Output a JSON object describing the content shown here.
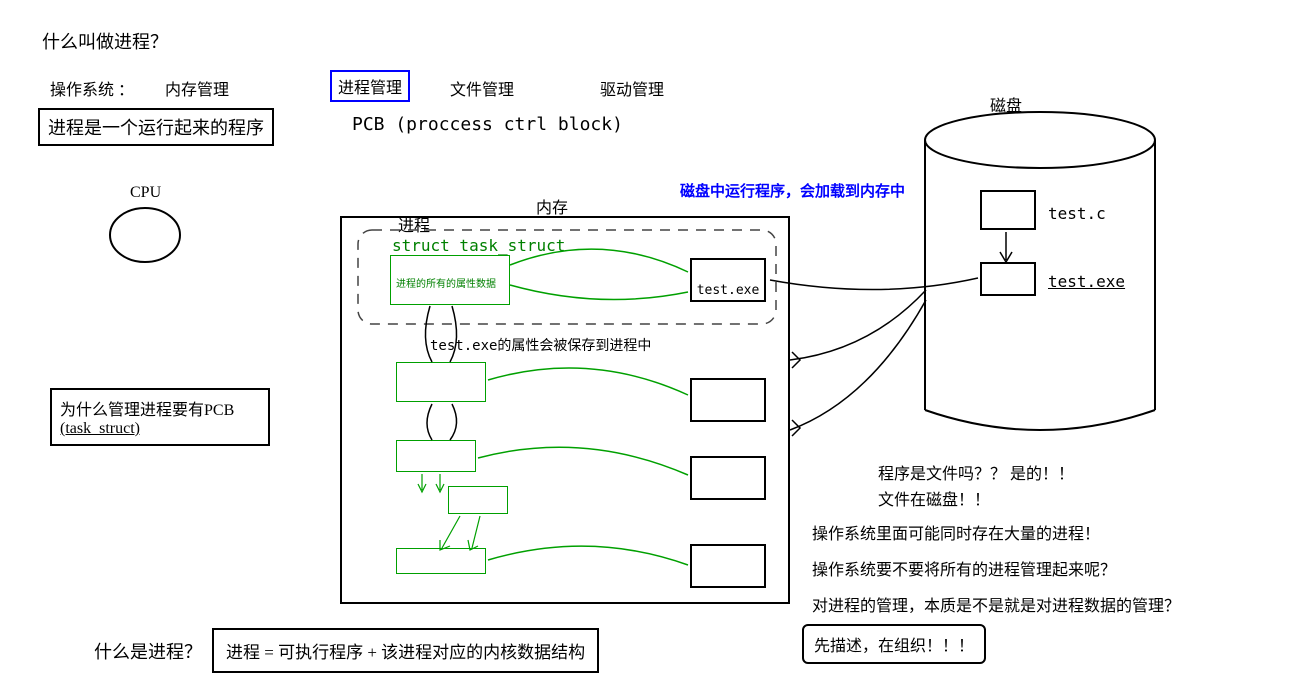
{
  "title_question": "什么叫做进程？",
  "os_label": "操作系统 ：",
  "os_items": {
    "mem": "内存管理",
    "proc": "进程管理",
    "file": "文件管理",
    "driver": "驱动管理"
  },
  "proc_def_box": "进程是一个运行起来的程序",
  "pcb_label": "PCB (proccess ctrl block)",
  "cpu_label": "CPU",
  "why_pcb_line1": "为什么管理进程要有PCB",
  "why_pcb_line2": "(task_struct)",
  "memory_label": "内存",
  "process_label": "进程",
  "struct_label": "struct task_struct",
  "struct_inner": "进程的所有的属性数据",
  "test_exe": "test.exe",
  "attr_note": "test.exe的属性会被保存到进程中",
  "disk_label": "磁盘",
  "disk_run_note": "磁盘中运行程序，会加载到内存中",
  "disk_file_c": "test.c",
  "disk_file_exe": "test.exe",
  "right_notes": {
    "n1": "程序是文件吗？？ 是的！！",
    "n2": "文件在磁盘！！",
    "n3": "操作系统里面可能同时存在大量的进程！",
    "n4": "操作系统要不要将所有的进程管理起来呢？",
    "n5": "对进程的管理，本质是不是就是对进程数据的管理？"
  },
  "describe_org": "先描述，在组织！！！",
  "bottom_q": "什么是进程？",
  "bottom_def": "进程 = 可执行程序 + 该进程对应的内核数据结构"
}
